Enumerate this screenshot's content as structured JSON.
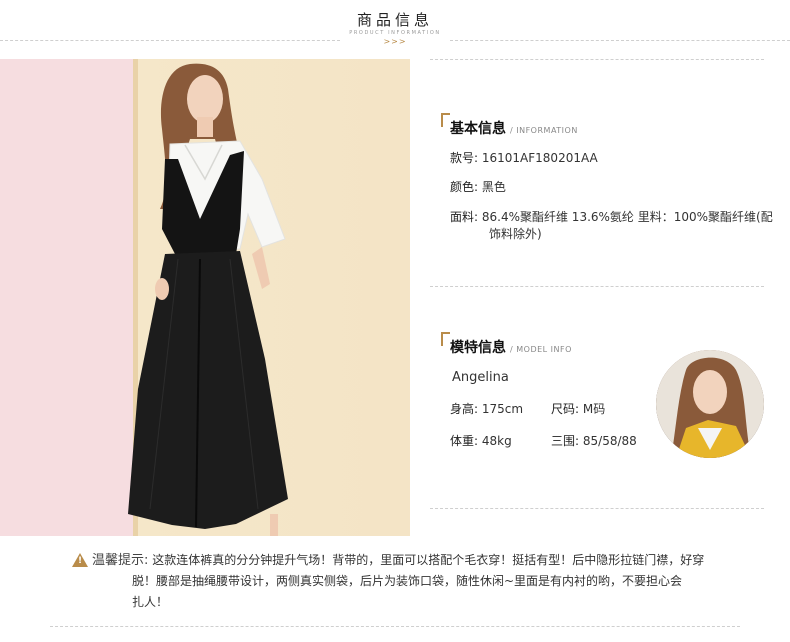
{
  "header": {
    "title": "商品信息",
    "subtitle": "PRODUCT INFORMATION",
    "arrows": ">>>"
  },
  "basic_info": {
    "title": "基本信息",
    "subtitle": "/ INFORMATION",
    "rows": [
      {
        "label": "款号:",
        "value": "16101AF180201AA"
      },
      {
        "label": "颜色:",
        "value": "黑色"
      },
      {
        "label": "面料:",
        "value": "86.4%聚酯纤维 13.6%氨纶 里料：100%聚酯纤维(配",
        "value2": "饰料除外)"
      }
    ]
  },
  "model_info": {
    "title": "模特信息",
    "subtitle": "/ MODEL INFO",
    "name": "Angelina",
    "height_label": "身高:",
    "height_value": "175cm",
    "size_label": "尺码:",
    "size_value": "M码",
    "weight_label": "体重:",
    "weight_value": "48kg",
    "measure_label": "三围:",
    "measure_value": "85/58/88"
  },
  "notice": {
    "label": "温馨提示:",
    "line1": "这款连体裤真的分分钟提升气场！背带的，里面可以搭配个毛衣穿！挺括有型！后中隐形拉链门襟，好穿",
    "line2": "脱！腰部是抽绳腰带设计，两侧真实侧袋，后片为装饰口袋，随性休闲~里面是有内衬的哟，不要担心会",
    "line3": "扎人！"
  },
  "colors": {
    "accent": "#b98c4a",
    "pink_bg": "#f6dde0",
    "cream_bg": "#f5e7c9",
    "garment": "#1a1a1a"
  }
}
